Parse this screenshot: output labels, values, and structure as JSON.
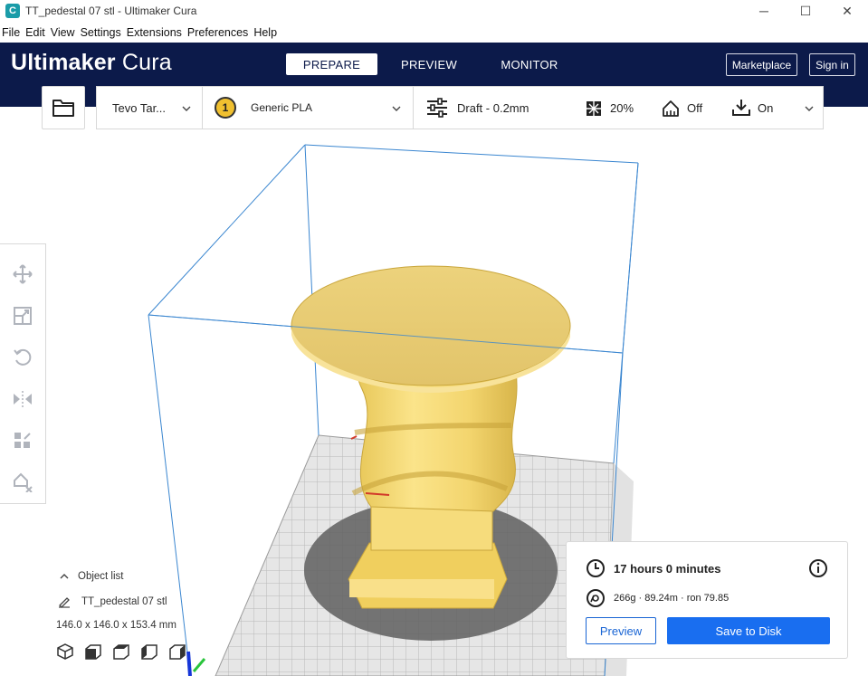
{
  "window": {
    "title": "TT_pedestal 07 stl - Ultimaker Cura",
    "app_icon_letter": "C",
    "minimize": "─",
    "maximize": "☐",
    "close": "✕"
  },
  "menu": [
    "File",
    "Edit",
    "View",
    "Settings",
    "Extensions",
    "Preferences",
    "Help"
  ],
  "header": {
    "logo_bold": "Ultimaker",
    "logo_light": "Cura",
    "tabs": [
      {
        "label": "PREPARE",
        "active": true
      },
      {
        "label": "PREVIEW",
        "active": false
      },
      {
        "label": "MONITOR",
        "active": false
      }
    ],
    "marketplace_label": "Marketplace",
    "signin_label": "Sign in"
  },
  "toolbar": {
    "printer": "Tevo Tar...",
    "extruder_number": "1",
    "material": "Generic PLA",
    "profile": "Draft - 0.2mm",
    "infill": "20%",
    "support": "Off",
    "adhesion": "On"
  },
  "object_list": {
    "header": "Object list",
    "object_name": "TT_pedestal 07 stl",
    "dimensions": "146.0 x 146.0 x 153.4 mm"
  },
  "print_info": {
    "time": "17 hours 0 minutes",
    "material_summary": "266g · 89.24m · ron 79.85",
    "preview_label": "Preview",
    "save_label": "Save to Disk"
  },
  "colors": {
    "header_bg": "#0c1a4a",
    "accent_blue": "#196ef0",
    "model_yellow": "#f5dc7a",
    "build_volume": "#3a86d0"
  }
}
